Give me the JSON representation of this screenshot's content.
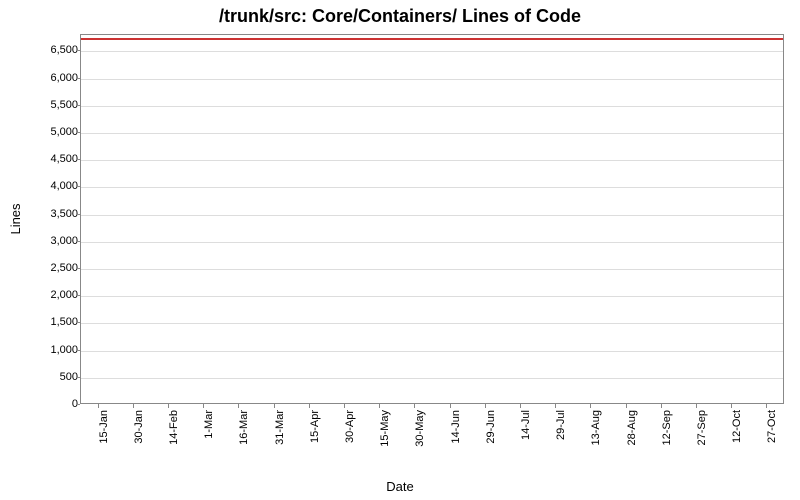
{
  "chart_data": {
    "type": "line",
    "title": "/trunk/src: Core/Containers/ Lines of Code",
    "xlabel": "Date",
    "ylabel": "Lines",
    "ylim": [
      0,
      6800
    ],
    "y_ticks": [
      0,
      500,
      1000,
      1500,
      2000,
      2500,
      3000,
      3500,
      4000,
      4500,
      5000,
      5500,
      6000,
      6500
    ],
    "y_tick_labels": [
      "0",
      "500",
      "1,000",
      "1,500",
      "2,000",
      "2,500",
      "3,000",
      "3,500",
      "4,000",
      "4,500",
      "5,000",
      "5,500",
      "6,000",
      "6,500"
    ],
    "x_ticks": [
      "15-Jan",
      "30-Jan",
      "14-Feb",
      "1-Mar",
      "16-Mar",
      "31-Mar",
      "15-Apr",
      "30-Apr",
      "15-May",
      "30-May",
      "14-Jun",
      "29-Jun",
      "14-Jul",
      "29-Jul",
      "13-Aug",
      "28-Aug",
      "12-Sep",
      "27-Sep",
      "12-Oct",
      "27-Oct"
    ],
    "series": [
      {
        "name": "Lines of Code",
        "color": "#cc3333",
        "value_constant": 6750
      }
    ]
  }
}
